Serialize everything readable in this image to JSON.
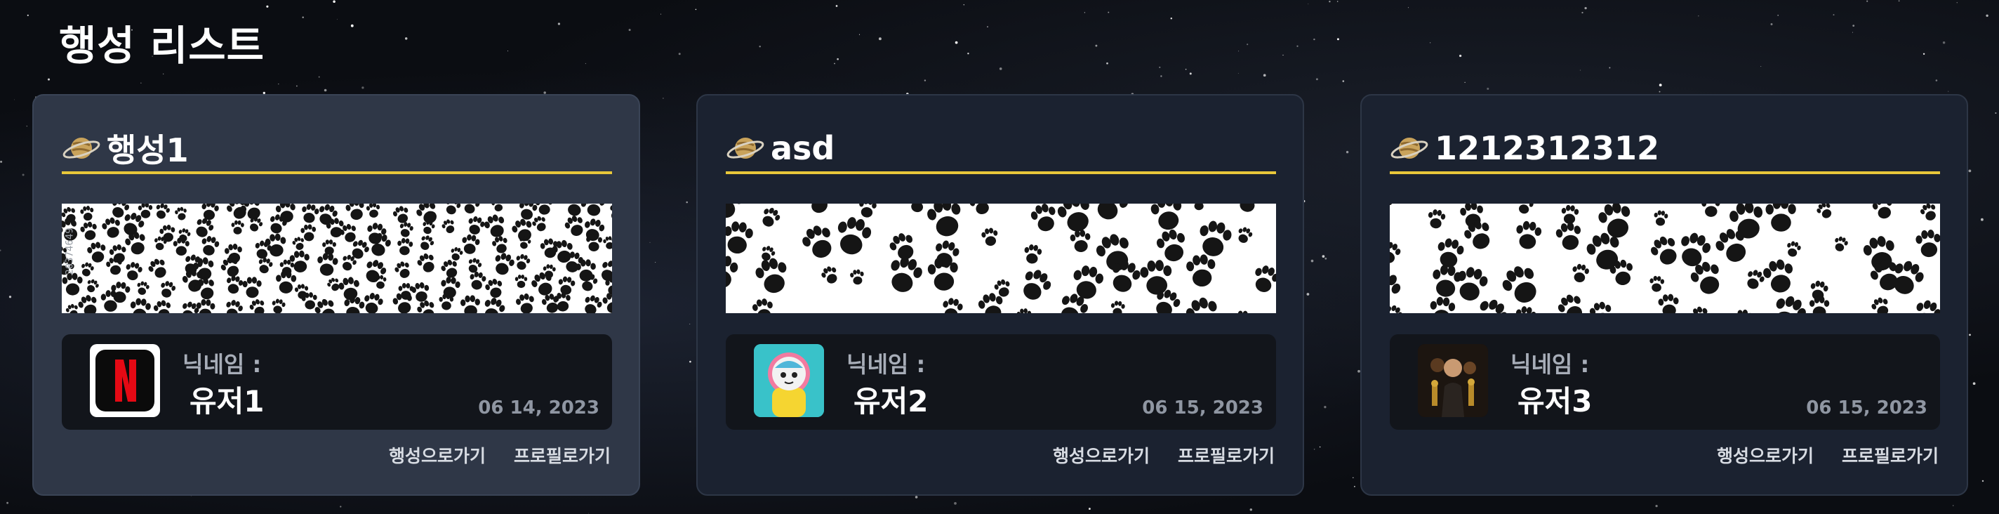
{
  "page": {
    "title": "행성 리스트"
  },
  "icons": {
    "planet": "planet-icon"
  },
  "colors": {
    "accent_line": "#e8c73a",
    "card_bg": "#1b2230",
    "card_active_bg": "#2f3747"
  },
  "planets": [
    {
      "title": "행성1",
      "avatar": "netflix-logo",
      "nickname_label": "닉네임 :",
      "user": "유저1",
      "date": "06 14, 2023",
      "go_planet": "행성으로가기",
      "go_profile": "프로필로가기",
      "banner_side_text": "20374649"
    },
    {
      "title": "asd",
      "avatar": "cartoon-cat-astronaut",
      "nickname_label": "닉네임 :",
      "user": "유저2",
      "date": "06 15, 2023",
      "go_planet": "행성으로가기",
      "go_profile": "프로필로가기"
    },
    {
      "title": "1212312312",
      "avatar": "person-photo",
      "nickname_label": "닉네임 :",
      "user": "유저3",
      "date": "06 15, 2023",
      "go_planet": "행성으로가기",
      "go_profile": "프로필로가기"
    }
  ]
}
